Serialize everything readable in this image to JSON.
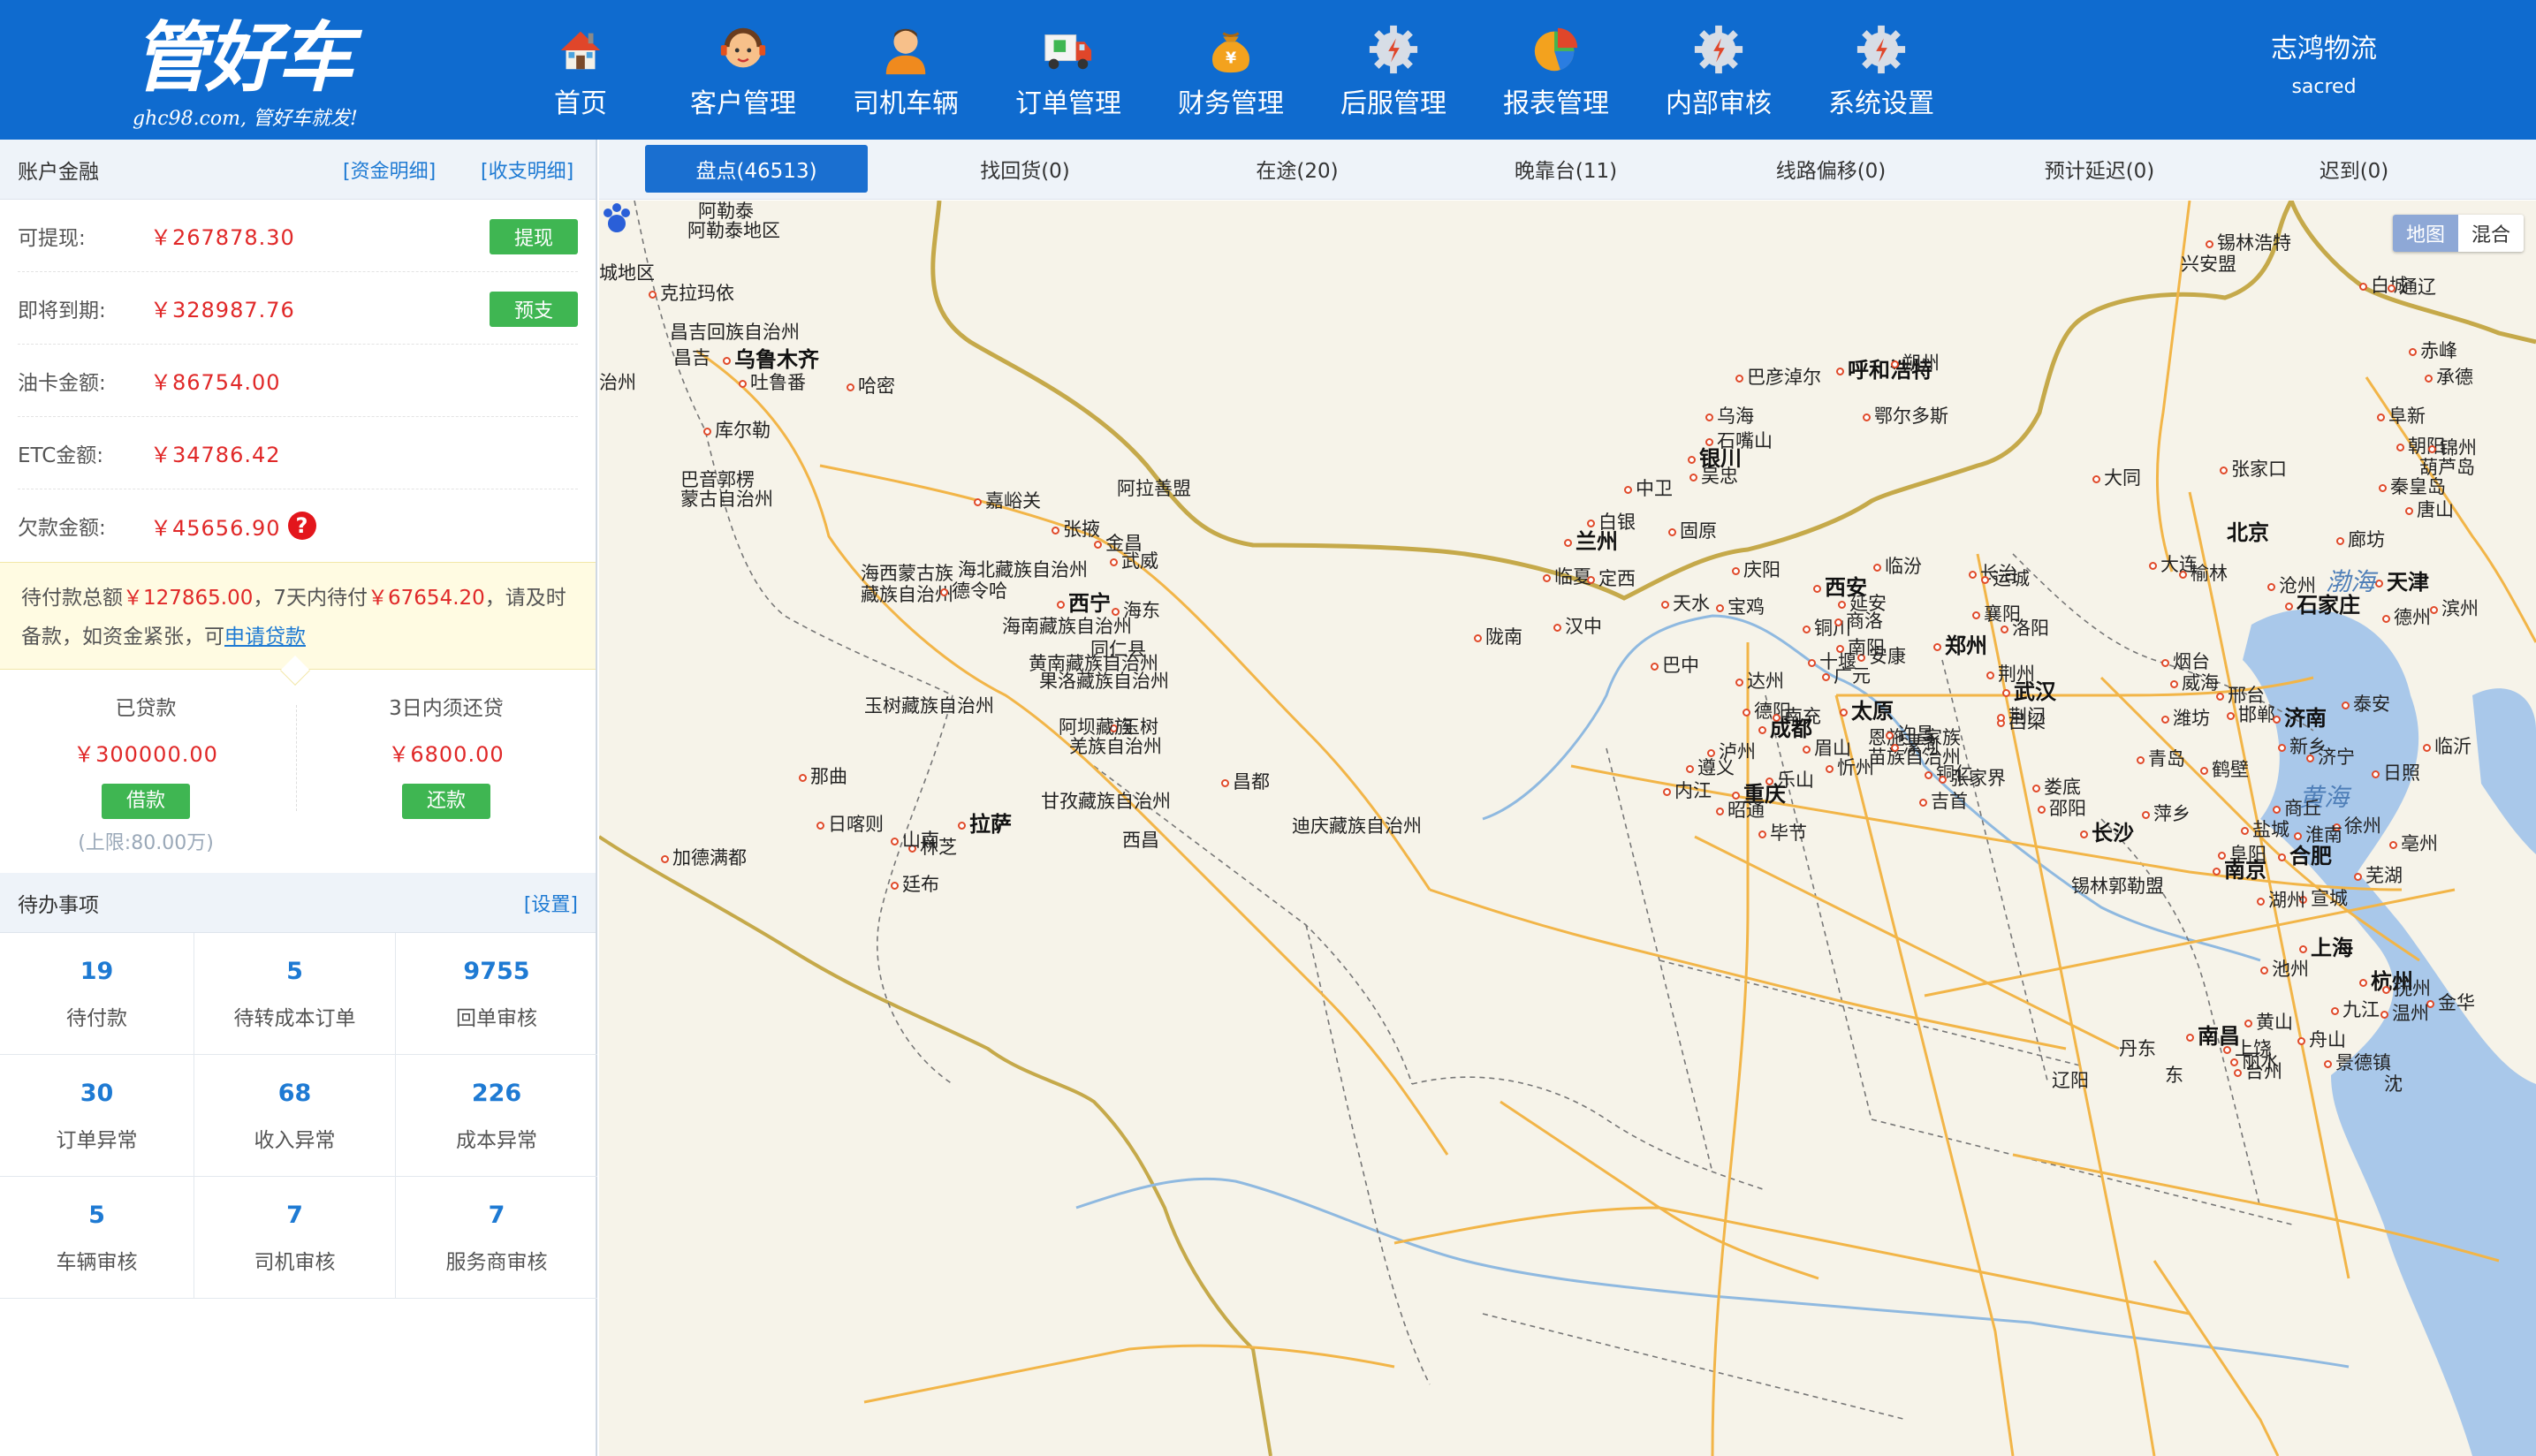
{
  "header": {
    "logo_text": "管好车",
    "logo_subtitle": "ghc98.com, 管好车就发!",
    "nav": [
      {
        "label": "首页",
        "icon": "home-icon"
      },
      {
        "label": "客户管理",
        "icon": "customer-service-icon"
      },
      {
        "label": "司机车辆",
        "icon": "driver-icon"
      },
      {
        "label": "订单管理",
        "icon": "truck-icon"
      },
      {
        "label": "财务管理",
        "icon": "money-bag-icon"
      },
      {
        "label": "后服管理",
        "icon": "gear-icon"
      },
      {
        "label": "报表管理",
        "icon": "pie-chart-icon"
      },
      {
        "label": "内部审核",
        "icon": "gear-icon"
      },
      {
        "label": "系统设置",
        "icon": "gear-icon"
      }
    ],
    "company": "志鸿物流",
    "username": "sacred"
  },
  "account": {
    "title": "账户金融",
    "link_funds": "[资金明细]",
    "link_income": "[收支明细]",
    "rows": [
      {
        "label": "可提现:",
        "value": "￥267878.30",
        "button": "提现"
      },
      {
        "label": "即将到期:",
        "value": "￥328987.76",
        "button": "预支"
      },
      {
        "label": "油卡金额:",
        "value": "￥86754.00",
        "button": ""
      },
      {
        "label": "ETC金额:",
        "value": "￥34786.42",
        "button": ""
      },
      {
        "label": "欠款金额:",
        "value": "￥45656.90",
        "button": ""
      }
    ],
    "help_mark": "?"
  },
  "notice": {
    "prefix": "待付款总额",
    "total": "￥127865.00",
    "mid": "，7天内待付",
    "week": "￥67654.20",
    "suffix": "，请及时备款，如资金紧张，可",
    "link": "申请贷款"
  },
  "loan": {
    "borrowed_title": "已贷款",
    "borrowed_value": "￥300000.00",
    "borrow_button": "借款",
    "limit": "(上限:80.00万)",
    "repay_title": "3日内须还贷",
    "repay_value": "￥6800.00",
    "repay_button": "还款"
  },
  "todo": {
    "title": "待办事项",
    "settings": "[设置]",
    "items": [
      {
        "count": "19",
        "label": "待付款"
      },
      {
        "count": "5",
        "label": "待转成本订单"
      },
      {
        "count": "9755",
        "label": "回单审核"
      },
      {
        "count": "30",
        "label": "订单异常"
      },
      {
        "count": "68",
        "label": "收入异常"
      },
      {
        "count": "226",
        "label": "成本异常"
      },
      {
        "count": "5",
        "label": "车辆审核"
      },
      {
        "count": "7",
        "label": "司机审核"
      },
      {
        "count": "7",
        "label": "服务商审核"
      }
    ]
  },
  "tabs": [
    {
      "label": "盘点(46513)"
    },
    {
      "label": "找回货(0)"
    },
    {
      "label": "在途(20)"
    },
    {
      "label": "晚靠台(11)"
    },
    {
      "label": "线路偏移(0)"
    },
    {
      "label": "预计延迟(0)"
    },
    {
      "label": "迟到(0)"
    }
  ],
  "map": {
    "toggle_map": "地图",
    "toggle_mix": "混合",
    "labels": [
      {
        "name": "阿勒泰",
        "dot": false
      },
      {
        "name": "阿勒泰地区",
        "dot": false
      },
      {
        "name": "城地区",
        "dot": false
      },
      {
        "name": "克拉玛依",
        "dot": true
      },
      {
        "name": "昌吉回族自治州",
        "dot": false
      },
      {
        "name": "昌吉",
        "dot": false
      },
      {
        "name": "乌鲁木齐",
        "dot": true,
        "big": true
      },
      {
        "name": "吐鲁番",
        "dot": true
      },
      {
        "name": "哈密",
        "dot": true
      },
      {
        "name": "治州",
        "dot": false
      },
      {
        "name": "库尔勒",
        "dot": true
      },
      {
        "name": "巴音郭楞",
        "dot": false
      },
      {
        "name": "蒙古自治州",
        "dot": false
      },
      {
        "name": "嘉峪关",
        "dot": true
      },
      {
        "name": "阿拉善盟",
        "dot": false
      },
      {
        "name": "张掖",
        "dot": true
      },
      {
        "name": "金昌",
        "dot": true
      },
      {
        "name": "武威",
        "dot": true
      },
      {
        "name": "海北藏族自治州",
        "dot": false
      },
      {
        "name": "海西蒙古族",
        "dot": false
      },
      {
        "name": "藏族自治州",
        "dot": false
      },
      {
        "name": "德令哈",
        "dot": true
      },
      {
        "name": "西宁",
        "dot": true,
        "big": true
      },
      {
        "name": "海东",
        "dot": true
      },
      {
        "name": "海南藏族自治州",
        "dot": false
      },
      {
        "name": "同仁县",
        "dot": false
      },
      {
        "name": "黄南藏族自治州",
        "dot": false
      },
      {
        "name": "果洛藏族自治州",
        "dot": false
      },
      {
        "name": "玉树藏族自治州",
        "dot": false
      },
      {
        "name": "玉树",
        "dot": true
      },
      {
        "name": "阿坝藏族",
        "dot": false
      },
      {
        "name": "羌族自治州",
        "dot": false
      },
      {
        "name": "那曲",
        "dot": true
      },
      {
        "name": "昌都",
        "dot": true
      },
      {
        "name": "日喀则",
        "dot": true
      },
      {
        "name": "拉萨",
        "dot": true,
        "big": true
      },
      {
        "name": "林芝",
        "dot": true
      },
      {
        "name": "山南",
        "dot": true
      },
      {
        "name": "加德满都",
        "dot": true
      },
      {
        "name": "廷布",
        "dot": true
      },
      {
        "name": "甘孜藏族自治州",
        "dot": false
      },
      {
        "name": "迪庆藏族自治州",
        "dot": false
      },
      {
        "name": "西昌",
        "dot": false
      },
      {
        "name": "巴彦淖尔",
        "dot": true
      },
      {
        "name": "呼和浩特",
        "dot": true,
        "big": true
      },
      {
        "name": "乌海",
        "dot": true
      },
      {
        "name": "鄂尔多斯",
        "dot": true
      },
      {
        "name": "石嘴山",
        "dot": true
      },
      {
        "name": "银川",
        "dot": true,
        "big": true
      },
      {
        "name": "吴忠",
        "dot": true
      },
      {
        "name": "中卫",
        "dot": true
      },
      {
        "name": "白银",
        "dot": true
      },
      {
        "name": "兰州",
        "dot": true,
        "big": true
      },
      {
        "name": "临夏",
        "dot": true
      },
      {
        "name": "定西",
        "dot": true
      },
      {
        "name": "固原",
        "dot": true
      },
      {
        "name": "庆阳",
        "dot": true
      },
      {
        "name": "天水",
        "dot": true
      },
      {
        "name": "宝鸡",
        "dot": true
      },
      {
        "name": "西安",
        "dot": true,
        "big": true
      },
      {
        "name": "铜川",
        "dot": true
      },
      {
        "name": "商洛",
        "dot": true
      },
      {
        "name": "陇南",
        "dot": true
      },
      {
        "name": "汉中",
        "dot": true
      },
      {
        "name": "安康",
        "dot": true
      },
      {
        "name": "十堰",
        "dot": true
      },
      {
        "name": "广元",
        "dot": true
      },
      {
        "name": "巴中",
        "dot": true
      },
      {
        "name": "达州",
        "dot": true
      },
      {
        "name": "德阳",
        "dot": true
      },
      {
        "name": "南充",
        "dot": true
      },
      {
        "name": "成都",
        "dot": true,
        "big": true
      },
      {
        "name": "眉山",
        "dot": true
      },
      {
        "name": "乐山",
        "dot": true
      },
      {
        "name": "内江",
        "dot": true
      },
      {
        "name": "重庆",
        "dot": true,
        "big": true
      },
      {
        "name": "泸州",
        "dot": true
      },
      {
        "name": "遵义",
        "dot": true
      },
      {
        "name": "昭通",
        "dot": true
      },
      {
        "name": "毕节",
        "dot": true
      },
      {
        "name": "恩施土家族",
        "dot": false
      },
      {
        "name": "苗族自治州",
        "dot": false
      },
      {
        "name": "铜仁",
        "dot": true
      },
      {
        "name": "吉首",
        "dot": true
      },
      {
        "name": "张家界",
        "dot": true
      },
      {
        "name": "娄底",
        "dot": true
      },
      {
        "name": "邵阳",
        "dot": true
      },
      {
        "name": "长沙",
        "dot": true,
        "big": true
      },
      {
        "name": "萍乡",
        "dot": true
      },
      {
        "name": "榆林",
        "dot": true
      },
      {
        "name": "朔州",
        "dot": true
      },
      {
        "name": "忻州",
        "dot": true
      },
      {
        "name": "太原",
        "dot": true,
        "big": true
      },
      {
        "name": "吕梁",
        "dot": true
      },
      {
        "name": "延安",
        "dot": true
      },
      {
        "name": "临汾",
        "dot": true
      },
      {
        "name": "长治",
        "dot": true
      },
      {
        "name": "运城",
        "dot": true
      },
      {
        "name": "洛阳",
        "dot": true
      },
      {
        "name": "郑州",
        "dot": true,
        "big": true
      },
      {
        "name": "许昌",
        "dot": true
      },
      {
        "name": "漯河",
        "dot": true
      },
      {
        "name": "南阳",
        "dot": true
      },
      {
        "name": "襄阳",
        "dot": true
      },
      {
        "name": "荆门",
        "dot": true
      },
      {
        "name": "荆州",
        "dot": true
      },
      {
        "name": "武汉",
        "dot": true,
        "big": true
      },
      {
        "name": "锡林郭勒盟",
        "dot": false
      },
      {
        "name": "锡林浩特",
        "dot": true
      },
      {
        "name": "兴安盟",
        "dot": false
      },
      {
        "name": "白城",
        "dot": true
      },
      {
        "name": "通辽",
        "dot": true
      },
      {
        "name": "赤峰",
        "dot": true
      },
      {
        "name": "阜新",
        "dot": true
      },
      {
        "name": "朝阳",
        "dot": true
      },
      {
        "name": "锦州",
        "dot": true
      },
      {
        "name": "葫芦岛",
        "dot": false
      },
      {
        "name": "承德",
        "dot": true
      },
      {
        "name": "张家口",
        "dot": true
      },
      {
        "name": "大同",
        "dot": true
      },
      {
        "name": "北京",
        "dot": false,
        "big": true
      },
      {
        "name": "廊坊",
        "dot": true
      },
      {
        "name": "天津",
        "dot": true,
        "big": true
      },
      {
        "name": "唐山",
        "dot": true
      },
      {
        "name": "秦皇岛",
        "dot": true
      },
      {
        "name": "渤海",
        "dot": false,
        "sea": true
      },
      {
        "name": "大连",
        "dot": true
      },
      {
        "name": "沧州",
        "dot": true
      },
      {
        "name": "石家庄",
        "dot": true,
        "big": true
      },
      {
        "name": "德州",
        "dot": true
      },
      {
        "name": "滨州",
        "dot": true
      },
      {
        "name": "烟台",
        "dot": true
      },
      {
        "name": "威海",
        "dot": true
      },
      {
        "name": "邢台",
        "dot": true
      },
      {
        "name": "邯郸",
        "dot": true
      },
      {
        "name": "济南",
        "dot": true,
        "big": true
      },
      {
        "name": "泰安",
        "dot": true
      },
      {
        "name": "潍坊",
        "dot": true
      },
      {
        "name": "青岛",
        "dot": true
      },
      {
        "name": "鹤壁",
        "dot": true
      },
      {
        "name": "新乡",
        "dot": true
      },
      {
        "name": "济宁",
        "dot": true
      },
      {
        "name": "日照",
        "dot": true
      },
      {
        "name": "临沂",
        "dot": true
      },
      {
        "name": "黄海",
        "dot": false,
        "sea": true
      },
      {
        "name": "商丘",
        "dot": true
      },
      {
        "name": "徐州",
        "dot": true
      },
      {
        "name": "亳州",
        "dot": true
      },
      {
        "name": "盐城",
        "dot": true
      },
      {
        "name": "阜阳",
        "dot": true
      },
      {
        "name": "淮南",
        "dot": true
      },
      {
        "name": "合肥",
        "dot": true,
        "big": true
      },
      {
        "name": "南京",
        "dot": true,
        "big": true
      },
      {
        "name": "芜湖",
        "dot": true
      },
      {
        "name": "宣城",
        "dot": true
      },
      {
        "name": "湖州",
        "dot": true
      },
      {
        "name": "上海",
        "dot": true,
        "big": true
      },
      {
        "name": "池州",
        "dot": true
      },
      {
        "name": "杭州",
        "dot": true,
        "big": true
      },
      {
        "name": "九江",
        "dot": true
      },
      {
        "name": "黄山",
        "dot": true
      },
      {
        "name": "舟山",
        "dot": true
      },
      {
        "name": "景德镇",
        "dot": true
      },
      {
        "name": "金华",
        "dot": true
      },
      {
        "name": "南昌",
        "dot": true,
        "big": true
      },
      {
        "name": "上饶",
        "dot": true
      },
      {
        "name": "丽水",
        "dot": true
      },
      {
        "name": "台州",
        "dot": true
      },
      {
        "name": "抚州",
        "dot": true
      },
      {
        "name": "温州",
        "dot": true
      },
      {
        "name": "丹东",
        "dot": false
      },
      {
        "name": "辽阳",
        "dot": false
      },
      {
        "name": "沈",
        "dot": false
      },
      {
        "name": "东",
        "dot": false
      }
    ]
  }
}
